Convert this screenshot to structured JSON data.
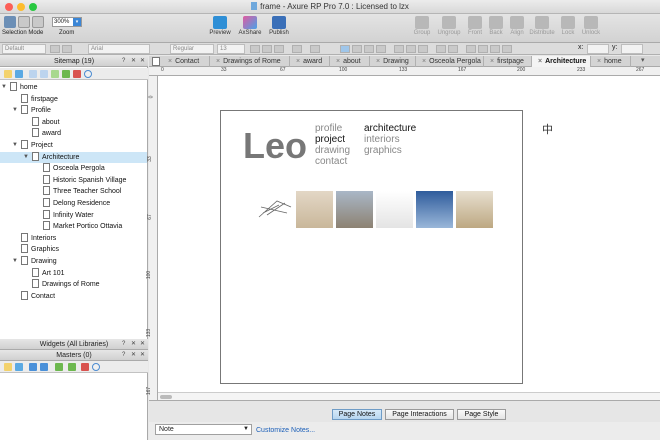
{
  "app": {
    "title": "frame - Axure RP Pro 7.0 : Licensed to lzx",
    "zoom": "300%"
  },
  "toolbar": {
    "selection_mode": "Selection Mode",
    "zoom_label": "Zoom",
    "buttons": [
      {
        "label": "Preview",
        "enabled": true
      },
      {
        "label": "AxShare",
        "enabled": true
      },
      {
        "label": "Publish",
        "enabled": true
      },
      {
        "label": "Group",
        "enabled": false
      },
      {
        "label": "Ungroup",
        "enabled": false
      },
      {
        "label": "Front",
        "enabled": false
      },
      {
        "label": "Back",
        "enabled": false
      },
      {
        "label": "Align",
        "enabled": false
      },
      {
        "label": "Distribute",
        "enabled": false
      },
      {
        "label": "Lock",
        "enabled": false
      },
      {
        "label": "Unlock",
        "enabled": false
      }
    ]
  },
  "format": {
    "style": "Default",
    "font": "Arial",
    "weight": "Regular",
    "size": "13",
    "x_label": "x:",
    "y_label": "y:"
  },
  "sitemap": {
    "title": "Sitemap (19)",
    "nodes": [
      {
        "label": "home",
        "depth": 0,
        "twisty": "▼"
      },
      {
        "label": "firstpage",
        "depth": 1,
        "twisty": ""
      },
      {
        "label": "Profile",
        "depth": 1,
        "twisty": "▼"
      },
      {
        "label": "about",
        "depth": 2,
        "twisty": ""
      },
      {
        "label": "award",
        "depth": 2,
        "twisty": ""
      },
      {
        "label": "Project",
        "depth": 1,
        "twisty": "▼"
      },
      {
        "label": "Architecture",
        "depth": 2,
        "twisty": "▼",
        "selected": true
      },
      {
        "label": "Osceola Pergola",
        "depth": 3,
        "twisty": ""
      },
      {
        "label": "Historic Spanish Village",
        "depth": 3,
        "twisty": ""
      },
      {
        "label": "Three Teacher School",
        "depth": 3,
        "twisty": ""
      },
      {
        "label": "Delong Residence",
        "depth": 3,
        "twisty": ""
      },
      {
        "label": "Infinity Water",
        "depth": 3,
        "twisty": ""
      },
      {
        "label": "Market Portico Ottavia",
        "depth": 3,
        "twisty": ""
      },
      {
        "label": "Interiors",
        "depth": 1,
        "twisty": ""
      },
      {
        "label": "Graphics",
        "depth": 1,
        "twisty": ""
      },
      {
        "label": "Drawing",
        "depth": 1,
        "twisty": "▼"
      },
      {
        "label": "Art 101",
        "depth": 2,
        "twisty": ""
      },
      {
        "label": "Drawings of Rome",
        "depth": 2,
        "twisty": ""
      },
      {
        "label": "Contact",
        "depth": 1,
        "twisty": ""
      }
    ]
  },
  "widgets": {
    "title": "Widgets (All Libraries)",
    "masters": "Masters (0)"
  },
  "tabs": [
    "Contact",
    "Drawings of Rome",
    "award",
    "about",
    "Drawing",
    "Osceola Pergola",
    "firstpage",
    "Architecture",
    "home"
  ],
  "active_tab": "Architecture",
  "hruler": [
    "0",
    "33",
    "67",
    "100",
    "133",
    "167",
    "200",
    "233",
    "267"
  ],
  "vruler": [
    "0",
    "33",
    "67",
    "100",
    "133",
    "167"
  ],
  "page": {
    "logo": "Leo",
    "nav_left": [
      "profile",
      "project",
      "drawing",
      "contact"
    ],
    "nav_right": [
      "architecture",
      "interiors",
      "graphics"
    ],
    "lang": "中"
  },
  "bottom_tabs": [
    "Page Notes",
    "Page Interactions",
    "Page Style"
  ],
  "active_bottom_tab": "Page Notes",
  "notes": {
    "select": "Note",
    "customize": "Customize Notes..."
  },
  "colors": {
    "accent": "#2a7fd4",
    "selection": "#cde6f7",
    "link": "#1c5fb8"
  }
}
